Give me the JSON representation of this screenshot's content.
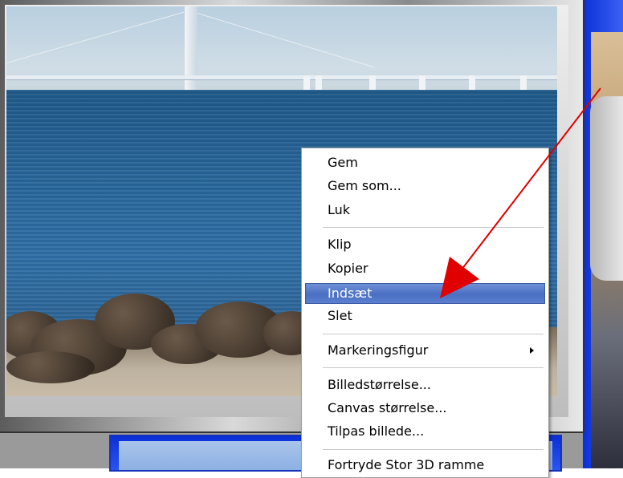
{
  "context_menu": {
    "items": [
      {
        "label": "Gem"
      },
      {
        "label": "Gem som..."
      },
      {
        "label": "Luk"
      },
      {
        "label": "Klip"
      },
      {
        "label": "Kopier"
      },
      {
        "label": "Indsæt",
        "highlighted": true
      },
      {
        "label": "Slet"
      },
      {
        "label": "Markeringsfigur",
        "has_submenu": true
      },
      {
        "label": "Billedstørrelse..."
      },
      {
        "label": "Canvas størrelse..."
      },
      {
        "label": "Tilpas billede..."
      },
      {
        "label": "Fortryde Stor 3D ramme"
      }
    ],
    "highlight_color": "#5a7ecd"
  },
  "annotation": {
    "icon": "red-arrow-icon",
    "color": "#e00000"
  }
}
